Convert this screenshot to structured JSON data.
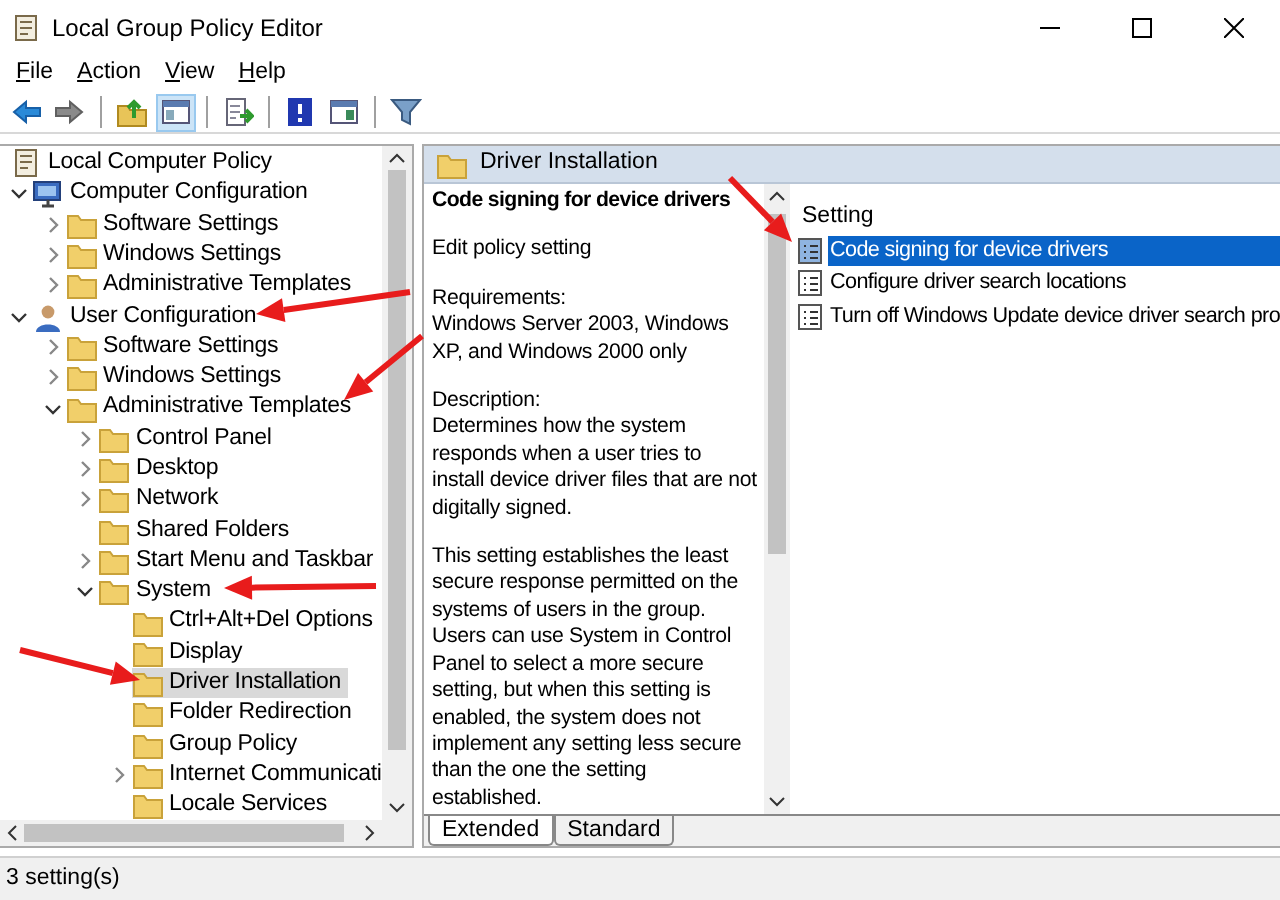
{
  "window": {
    "title": "Local Group Policy Editor"
  },
  "menu": [
    {
      "label": "File"
    },
    {
      "label": "Action"
    },
    {
      "label": "View"
    },
    {
      "label": "Help"
    }
  ],
  "toolbar_groups": [
    [
      {
        "kind": "back",
        "pressed": false
      },
      {
        "kind": "forward",
        "pressed": false
      }
    ],
    [
      {
        "kind": "up",
        "pressed": false
      },
      {
        "kind": "tree",
        "pressed": true
      }
    ],
    [
      {
        "kind": "export",
        "pressed": false
      }
    ],
    [
      {
        "kind": "help",
        "pressed": false
      },
      {
        "kind": "console",
        "pressed": false
      }
    ],
    [
      {
        "kind": "filter",
        "pressed": false
      }
    ]
  ],
  "tree": [
    {
      "label": "Local Computer Policy",
      "kind": "policy",
      "selected": false,
      "children": [
        {
          "label": "Computer Configuration",
          "kind": "computer",
          "expanded": true,
          "selected": false,
          "children": [
            {
              "label": "Software Settings",
              "expanded": false,
              "selected": false
            },
            {
              "label": "Windows Settings",
              "expanded": false,
              "selected": false
            },
            {
              "label": "Administrative Templates",
              "expanded": false,
              "selected": false
            }
          ]
        },
        {
          "label": "User Configuration",
          "kind": "user",
          "expanded": true,
          "selected": false,
          "children": [
            {
              "label": "Software Settings",
              "expanded": false,
              "selected": false
            },
            {
              "label": "Windows Settings",
              "expanded": false,
              "selected": false
            },
            {
              "label": "Administrative Templates",
              "expanded": true,
              "selected": false,
              "children": [
                {
                  "label": "Control Panel",
                  "expanded": false,
                  "selected": false
                },
                {
                  "label": "Desktop",
                  "expanded": false,
                  "selected": false
                },
                {
                  "label": "Network",
                  "expanded": false,
                  "selected": false
                },
                {
                  "label": "Shared Folders",
                  "selected": false
                },
                {
                  "label": "Start Menu and Taskbar",
                  "expanded": false,
                  "selected": false
                },
                {
                  "label": "System",
                  "expanded": true,
                  "selected": false,
                  "children": [
                    {
                      "label": "Ctrl+Alt+Del Options",
                      "selected": false
                    },
                    {
                      "label": "Display",
                      "selected": false
                    },
                    {
                      "label": "Driver Installation",
                      "selected": true
                    },
                    {
                      "label": "Folder Redirection",
                      "selected": false
                    },
                    {
                      "label": "Group Policy",
                      "selected": false
                    },
                    {
                      "label": "Internet Communicati",
                      "expanded": false,
                      "selected": false
                    },
                    {
                      "label": "Locale Services",
                      "selected": false
                    }
                  ]
                }
              ]
            }
          ]
        }
      ]
    }
  ],
  "header": {
    "title": "Driver Installation"
  },
  "details": {
    "title": "Code signing for device drivers",
    "edit_text": "Edit",
    "edit_link": "policy setting",
    "requirements_label": "Requirements:",
    "requirements": "Windows Server 2003, Windows XP, and Windows 2000 only",
    "description_label": "Description:",
    "description": "Determines how the system responds when a user tries to install device driver files that are not digitally signed.",
    "details": "This setting establishes the least secure response permitted on the systems of users in the group. Users can use System in Control Panel to select a more secure setting, but when this setting is enabled, the system does not implement any setting less secure than the one the setting established."
  },
  "settings": {
    "column": "Setting",
    "rows": [
      {
        "label": "Code signing for device drivers",
        "selected": true
      },
      {
        "label": "Configure driver search locations",
        "selected": false
      },
      {
        "label": "Turn off Windows Update device driver search pro",
        "selected": false
      }
    ]
  },
  "tabs": [
    {
      "label": "Extended",
      "selected": true
    },
    {
      "label": "Standard",
      "selected": false
    }
  ],
  "status_bar": "3 setting(s)"
}
